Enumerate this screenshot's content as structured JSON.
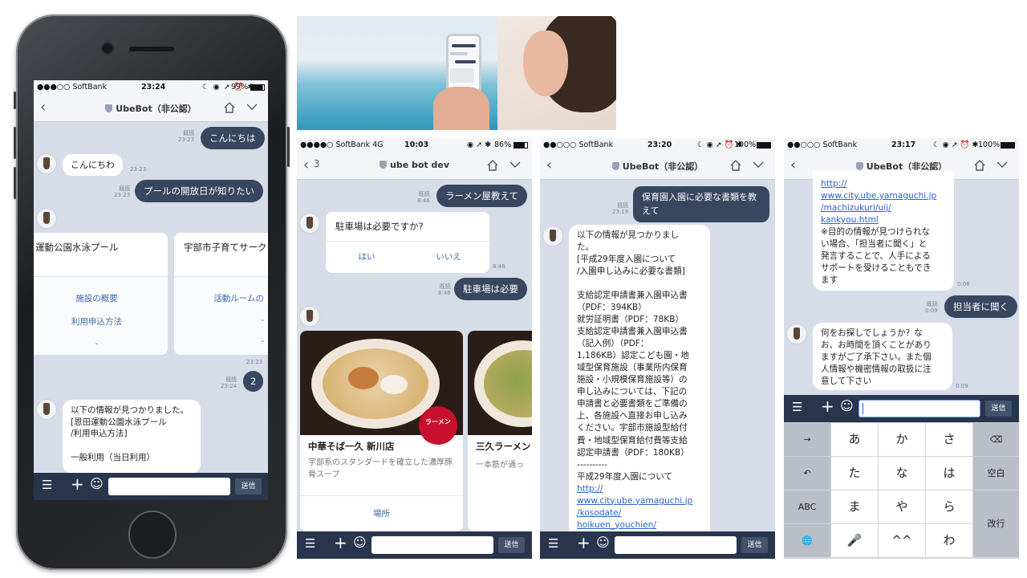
{
  "screen1": {
    "status": {
      "carrier": "●●●○○ SoftBank",
      "time": "23:24",
      "battery": "99%"
    },
    "title": "UbeBot（非公認）",
    "messages": [
      {
        "type": "out",
        "text": "こんにちは",
        "read": "既読",
        "time": "23:23"
      },
      {
        "type": "in",
        "text": "こんにちわ",
        "time": "23:23"
      },
      {
        "type": "out",
        "text": "プールの開放日が知りたい",
        "read": "既読",
        "time": "23:23"
      }
    ],
    "cards": [
      {
        "title": "運動公園水泳プール",
        "links": [
          "施設の概要",
          "利用申込方法",
          "-"
        ]
      },
      {
        "title": "宇部市子育てサーク",
        "links": [
          "活動ルームの",
          "-",
          "-"
        ]
      }
    ],
    "card_time": "23:23",
    "out2": {
      "text": "2",
      "read": "既読",
      "time": "23:24"
    },
    "reply": "以下の情報が見つかりました。\n[恩田運動公園水泳プール\n/利用申込方法]\n\n一般利用（当日利用）",
    "send": "送信"
  },
  "screen2": {
    "status": {
      "carrier": "●●●●○ SoftBank  4G",
      "time": "10:03",
      "battery": "86%"
    },
    "back_count": "3",
    "title": "ube bot dev",
    "msg1": {
      "text": "ラーメン屋教えて",
      "read": "既読",
      "time": "8:46"
    },
    "question": "駐車場は必要ですか?",
    "yes": "はい",
    "no": "いいえ",
    "q_time": "8:46",
    "msg2": {
      "text": "駐車場は必要",
      "read": "既読",
      "time": "8:46"
    },
    "food1": {
      "name": "中華そば一久 新川店",
      "desc": "宇部系のスタンダードを確立した濃厚豚骨スープ",
      "link": "場所",
      "badge": "ラーメン"
    },
    "food2": {
      "name": "三久ラーメン",
      "desc": "一本筋が通っ"
    },
    "send": "送信"
  },
  "screen3": {
    "status": {
      "carrier": "●●○○○ SoftBank",
      "time": "23:20",
      "battery": "100%"
    },
    "title": "UbeBot（非公認）",
    "msg": {
      "text": "保育園入園に必要な書類を教えて",
      "read": "既読",
      "time": "23:19"
    },
    "reply_lines": [
      "以下の情報が見つかりまし",
      "た。",
      "[平成29年度入園について",
      "/入園申し込みに必要な書類]",
      "",
      "支給認定申請書兼入園申込書",
      "（PDF：394KB）",
      "就労証明書（PDF：78KB）",
      "支給認定申請書兼入園申込書",
      "（記入例）（PDF：",
      "1,186KB）認定こども園・地",
      "域型保育施設（事業所内保育",
      "施設・小規模保育施設等）の",
      "申し込みについては、下記の",
      "申請書と必要書類をご準備の",
      "上、各施設へ直接お申し込み",
      "ください。宇部市施設型給付",
      "費・地域型保育給付費等支給",
      "認定申請書（PDF：180KB）",
      "----------",
      "平成29年度入園について"
    ],
    "link_lines": [
      "http://",
      "www.city.ube.yamaguchi.jp",
      "/kosodate/",
      "hoikuen_youchien/"
    ],
    "send": "送信"
  },
  "screen4": {
    "status": {
      "carrier": "●●○○○ SoftBank",
      "time": "23:17",
      "battery": "100%"
    },
    "title": "UbeBot（非公認）",
    "link_lines": [
      "http://",
      "www.city.ube.yamaguchi.jp",
      "/machizukuri/uij/",
      "kankyou.html"
    ],
    "note_lines": [
      "※目的の情報が見つけられな",
      "い場合、「担当者に聞く」と",
      "発言することで、人手による",
      "サポートを受けることもでき",
      "ます"
    ],
    "note_time": "0:08",
    "msg": {
      "text": "担当者に聞く",
      "read": "既読",
      "time": "0:09"
    },
    "reply_lines": [
      "何をお探しでしょうか？な",
      "お、お時間を頂くことがあり",
      "ますがご了承下さい。また個",
      "人情報や機密情報の取扱に注",
      "意して下さい"
    ],
    "reply_time": "0:09",
    "send": "送信",
    "keys": {
      "r1": [
        "→",
        "あ",
        "か",
        "さ",
        "⌫"
      ],
      "r2": [
        "↶",
        "た",
        "な",
        "は",
        "空白"
      ],
      "r3": [
        "ABC",
        "ま",
        "や",
        "ら",
        "改行"
      ],
      "r4": [
        "🌐",
        "🎤",
        "^^",
        "わ",
        "、。?!"
      ]
    }
  }
}
